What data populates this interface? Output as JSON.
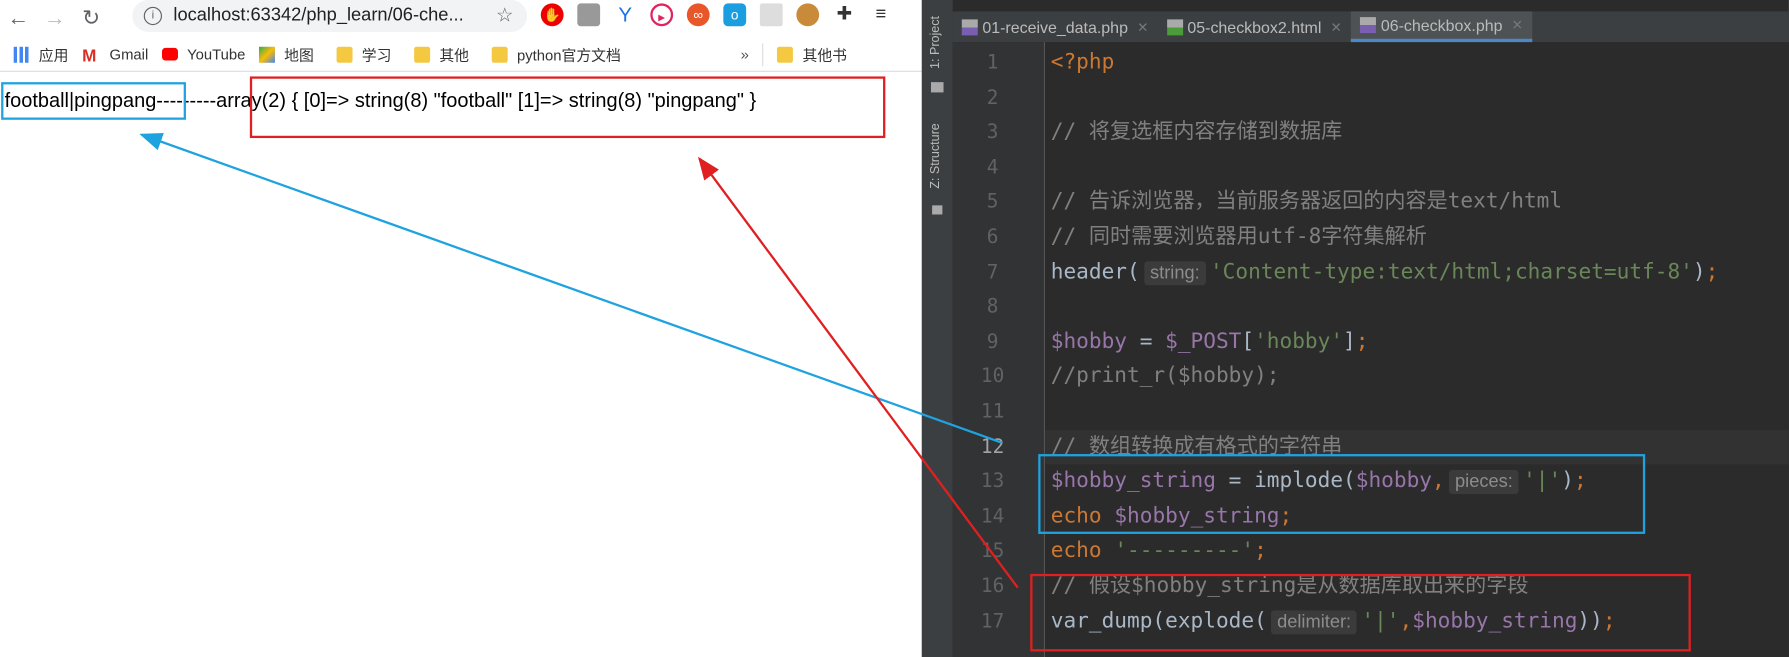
{
  "browser": {
    "url": "localhost:63342/php_learn/06-che...",
    "bookmarks": [
      {
        "label": "应用",
        "icon": "apps-grid-icon"
      },
      {
        "label": "Gmail",
        "icon": "gmail-icon"
      },
      {
        "label": "YouTube",
        "icon": "youtube-icon"
      },
      {
        "label": "地图",
        "icon": "maps-icon"
      },
      {
        "label": "学习",
        "icon": "folder-icon"
      },
      {
        "label": "其他",
        "icon": "folder-icon"
      },
      {
        "label": "python官方文档",
        "icon": "folder-icon"
      }
    ],
    "more_label": "»",
    "other_bookmarks": "其他书",
    "output_implode": "football|pingpang",
    "output_separator": "---------",
    "output_dump": "array(2) { [0]=> string(8) \"football\" [1]=> string(8) \"pingpang\" }"
  },
  "ide": {
    "side_tabs": [
      "1: Project",
      "Z: Structure"
    ],
    "tabs": [
      {
        "label": "01-receive_data.php",
        "type": "PHP",
        "active": false
      },
      {
        "label": "05-checkbox2.html",
        "type": "H",
        "active": false
      },
      {
        "label": "06-checkbox.php",
        "type": "PHP",
        "active": true
      }
    ],
    "current_line": 12,
    "lines": [
      [
        {
          "t": "<?php",
          "c": "kw"
        }
      ],
      [],
      [
        {
          "t": "// 将复选框内容存储到数据库",
          "c": "cm"
        }
      ],
      [],
      [
        {
          "t": "// 告诉浏览器，当前服务器返回的内容是text/html",
          "c": "cm"
        }
      ],
      [
        {
          "t": "// 同时需要浏览器用utf-8字符集解析",
          "c": "cm"
        }
      ],
      [
        {
          "t": "header(",
          "c": "fn"
        },
        {
          "t": "string:",
          "c": "hint"
        },
        {
          "t": "'Content-type:text/html;charset=utf-8'",
          "c": "str"
        },
        {
          "t": ")",
          "c": "fn"
        },
        {
          "t": ";",
          "c": "semi"
        }
      ],
      [],
      [
        {
          "t": "$hobby",
          "c": "var"
        },
        {
          "t": " = ",
          "c": "fn"
        },
        {
          "t": "$_POST",
          "c": "var"
        },
        {
          "t": "[",
          "c": "fn"
        },
        {
          "t": "'hobby'",
          "c": "str"
        },
        {
          "t": "]",
          "c": "fn"
        },
        {
          "t": ";",
          "c": "semi"
        }
      ],
      [
        {
          "t": "//print_r($hobby);",
          "c": "cm"
        }
      ],
      [],
      [
        {
          "t": "// 数组转换成有格式的字符串",
          "c": "cm"
        }
      ],
      [
        {
          "t": "$hobby_string",
          "c": "var"
        },
        {
          "t": " = implode(",
          "c": "fn"
        },
        {
          "t": "$hobby",
          "c": "var"
        },
        {
          "t": ",",
          "c": "semi"
        },
        {
          "t": "pieces:",
          "c": "hint"
        },
        {
          "t": "'|'",
          "c": "str"
        },
        {
          "t": ")",
          "c": "fn"
        },
        {
          "t": ";",
          "c": "semi"
        }
      ],
      [
        {
          "t": "echo ",
          "c": "kw"
        },
        {
          "t": "$hobby_string",
          "c": "var"
        },
        {
          "t": ";",
          "c": "semi"
        }
      ],
      [
        {
          "t": "echo ",
          "c": "kw"
        },
        {
          "t": "'---------'",
          "c": "str"
        },
        {
          "t": ";",
          "c": "semi"
        }
      ],
      [
        {
          "t": "// 假设$hobby_string是从数据库取出来的字段",
          "c": "cm"
        }
      ],
      [
        {
          "t": "var_dump(explode(",
          "c": "fn"
        },
        {
          "t": "delimiter:",
          "c": "hint"
        },
        {
          "t": "'|'",
          "c": "str"
        },
        {
          "t": ",",
          "c": "semi"
        },
        {
          "t": "$hobby_string",
          "c": "var"
        },
        {
          "t": "))",
          "c": "fn"
        },
        {
          "t": ";",
          "c": "semi"
        }
      ]
    ]
  },
  "annotation_colors": {
    "implode": "#1fa3e0",
    "explode": "#e02020"
  }
}
